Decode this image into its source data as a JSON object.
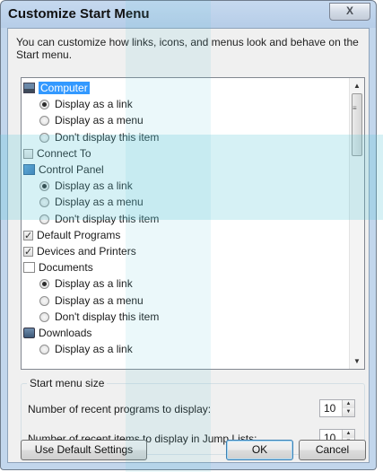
{
  "window": {
    "title": "Customize Start Menu",
    "close_label": "X"
  },
  "description": "You can customize how links, icons, and menus look and behave on the Start menu.",
  "list": {
    "items": [
      {
        "kind": "header-icon",
        "icon": "computer-icon",
        "label": "Computer",
        "selected": true
      },
      {
        "kind": "radio",
        "label": "Display as a link",
        "checked": true
      },
      {
        "kind": "radio",
        "label": "Display as a menu",
        "checked": false
      },
      {
        "kind": "radio",
        "label": "Don't display this item",
        "checked": false
      },
      {
        "kind": "checkbox",
        "label": "Connect To",
        "checked": false
      },
      {
        "kind": "header-icon",
        "icon": "control-panel-icon",
        "label": "Control Panel",
        "selected": false
      },
      {
        "kind": "radio",
        "label": "Display as a link",
        "checked": true
      },
      {
        "kind": "radio",
        "label": "Display as a menu",
        "checked": false
      },
      {
        "kind": "radio",
        "label": "Don't display this item",
        "checked": false
      },
      {
        "kind": "checkbox",
        "label": "Default Programs",
        "checked": true
      },
      {
        "kind": "checkbox",
        "label": "Devices and Printers",
        "checked": true
      },
      {
        "kind": "header-icon",
        "icon": "documents-icon",
        "label": "Documents",
        "selected": false
      },
      {
        "kind": "radio",
        "label": "Display as a link",
        "checked": true
      },
      {
        "kind": "radio",
        "label": "Display as a menu",
        "checked": false
      },
      {
        "kind": "radio",
        "label": "Don't display this item",
        "checked": false
      },
      {
        "kind": "header-icon",
        "icon": "downloads-icon",
        "label": "Downloads",
        "selected": false
      },
      {
        "kind": "radio",
        "label": "Display as a link",
        "checked": false
      }
    ]
  },
  "start_menu_size": {
    "legend": "Start menu size",
    "recent_programs_label": "Number of recent programs to display:",
    "recent_programs_value": "10",
    "recent_items_label": "Number of recent items to display in Jump Lists:",
    "recent_items_value": "10"
  },
  "buttons": {
    "default_settings": "Use Default Settings",
    "ok": "OK",
    "cancel": "Cancel"
  }
}
